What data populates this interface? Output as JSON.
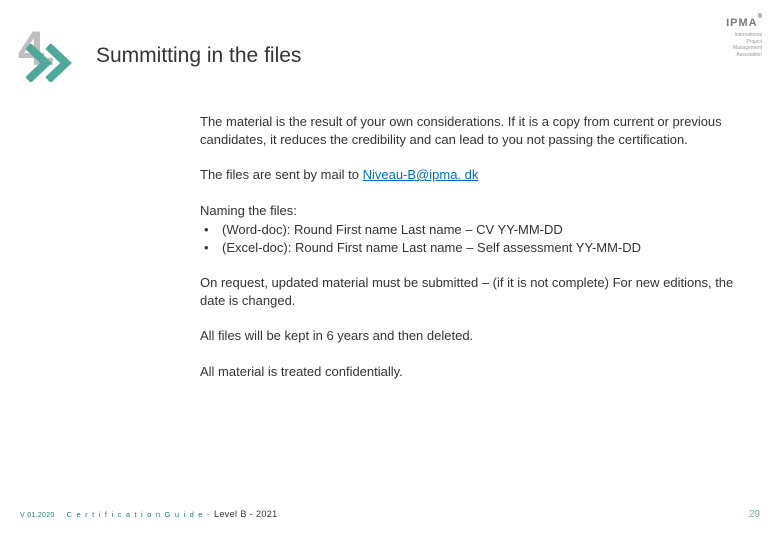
{
  "header": {
    "number": "4.",
    "title": "Summitting in the files"
  },
  "logo": {
    "main": "IPMA",
    "reg": "®",
    "sub1": "International",
    "sub2": "Project",
    "sub3": "Management",
    "sub4": "Association"
  },
  "body": {
    "p1": "The material is the result of your own considerations. If it is a copy from current or previous candidates, it reduces the credibility and can lead to you not passing the certification.",
    "p2_prefix": "The files are sent by mail to ",
    "p2_link": "Niveau-B@ipma. dk",
    "naming_title": "Naming the files:",
    "naming_b1": "(Word-doc): Round First name Last name – CV YY-MM-DD",
    "naming_b2": "(Excel-doc):  Round First name Last name – Self assessment YY-MM-DD",
    "p3": "On request, updated material must be submitted – (if it is not complete) For new editions, the date is changed.",
    "p4": "All files will be kept in 6 years and then deleted.",
    "p5": "All material is treated confidentially."
  },
  "footer": {
    "version": "V 01.2020",
    "guide_label": "C e r t i f i c a t i o n   G u i d e  - ",
    "guide_sub": "Level B - 2021",
    "page": "29"
  },
  "colors": {
    "accent": "#4fa89c"
  }
}
